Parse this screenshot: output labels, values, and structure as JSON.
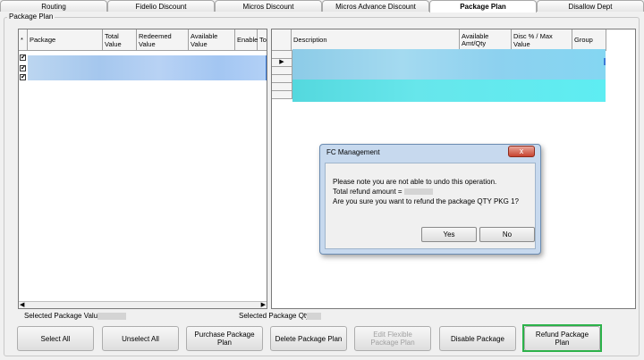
{
  "tabs": [
    {
      "label": "Routing"
    },
    {
      "label": "Fidelio Discount"
    },
    {
      "label": "Micros Discount"
    },
    {
      "label": "Micros Advance Discount"
    },
    {
      "label": "Package Plan",
      "active": true
    },
    {
      "label": "Disallow Dept"
    }
  ],
  "group_label": "Package Plan",
  "left_grid": {
    "columns": [
      "*",
      "Package",
      "Total Value",
      "Redeemed Value",
      "Available Value",
      "Enable",
      "Total Qt"
    ],
    "rows_checked": [
      true,
      true,
      true
    ]
  },
  "right_grid": {
    "columns": [
      "Description",
      "Available Amt/Qty",
      "Disc % / Max Value",
      "Group"
    ],
    "current_row_marker": "▶"
  },
  "selected_value_label": "Selected Package Value:",
  "selected_qty_label": "Selected Package Qty:",
  "buttons": {
    "select_all": "Select All",
    "unselect_all": "Unselect All",
    "purchase": "Purchase Package Plan",
    "delete": "Delete Package Plan",
    "edit_flexible": "Edit Flexible Package Plan",
    "disable": "Disable Package",
    "refund": "Refund Package Plan"
  },
  "dialog": {
    "title": "FC Management",
    "close": "x",
    "line1": "Please note you are not able to undo this operation.",
    "line2": "Total refund amount =",
    "line3": "Are you sure you want to refund the package QTY PKG 1?",
    "yes": "Yes",
    "no": "No"
  },
  "colors": {
    "highlight": "#2cb24a",
    "blur_blue": "#a9cdf3",
    "blur_cyan": "#5fe9ee"
  }
}
